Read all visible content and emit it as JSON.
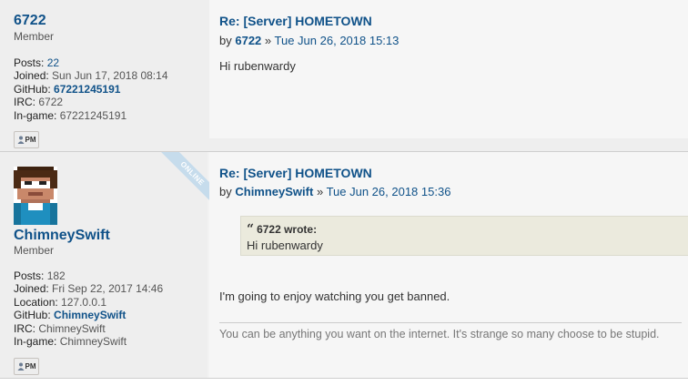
{
  "posts": [
    {
      "username": "6722",
      "rank": "Member",
      "stats": {
        "posts_label": "Posts:",
        "posts": "22",
        "joined_label": "Joined:",
        "joined": "Sun Jun 17, 2018 08:14",
        "github_label": "GitHub:",
        "github": "67221245191",
        "irc_label": "IRC:",
        "irc": "6722",
        "ingame_label": "In-game:",
        "ingame": "67221245191"
      },
      "pm_label": "PM",
      "title": "Re: [Server] HOMETOWN",
      "by": "by",
      "author": "6722",
      "sep": "»",
      "date": "Tue Jun 26, 2018 15:13",
      "content": "Hi rubenwardy"
    },
    {
      "username": "ChimneySwift",
      "rank": "Member",
      "online_badge": "ONLINE",
      "stats": {
        "posts_label": "Posts:",
        "posts": "182",
        "joined_label": "Joined:",
        "joined": "Fri Sep 22, 2017 14:46",
        "location_label": "Location:",
        "location": "127.0.0.1",
        "github_label": "GitHub:",
        "github": "ChimneySwift",
        "irc_label": "IRC:",
        "irc": "ChimneySwift",
        "ingame_label": "In-game:",
        "ingame": "ChimneySwift"
      },
      "pm_label": "PM",
      "title": "Re: [Server] HOMETOWN",
      "by": "by",
      "author": "ChimneySwift",
      "sep": "»",
      "date": "Tue Jun 26, 2018 15:36",
      "quote": {
        "author": "6722 wrote:",
        "text": "Hi rubenwardy"
      },
      "content": "I'm going to enjoy watching you get banned.",
      "signature": "You can be anything you want on the internet. It's strange so many choose to be stupid."
    }
  ],
  "colors": {
    "link": "#105289",
    "ribbon": "#c6dcec",
    "quote_bg": "#ebeadd"
  }
}
